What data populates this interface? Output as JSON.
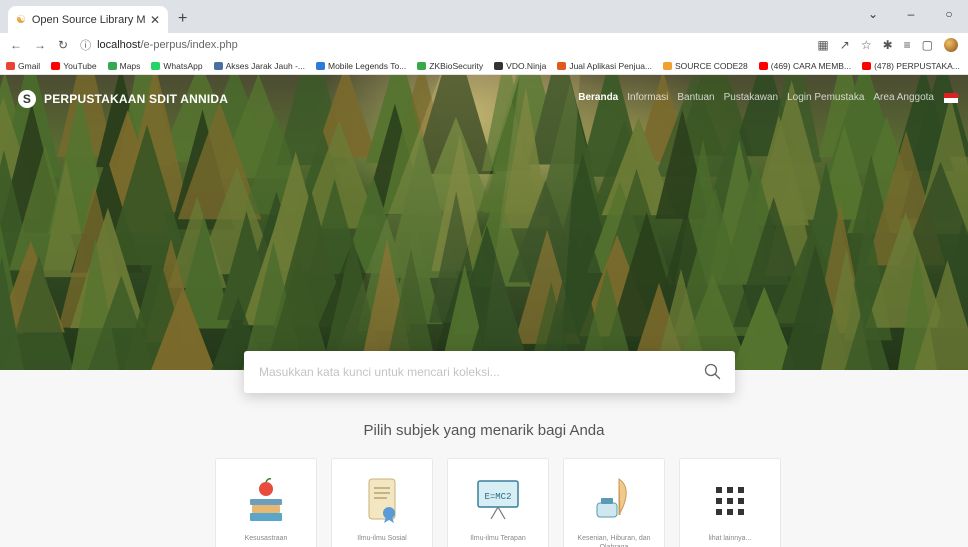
{
  "browser": {
    "tab_title": "Open Source Library Manageme",
    "url_host": "localhost",
    "url_path": "/e-perpus/index.php",
    "bookmarks": [
      {
        "label": "Gmail",
        "color": "#ea4335"
      },
      {
        "label": "YouTube",
        "color": "#ff0000"
      },
      {
        "label": "Maps",
        "color": "#34a853"
      },
      {
        "label": "WhatsApp",
        "color": "#25d366"
      },
      {
        "label": "Akses Jarak Jauh -...",
        "color": "#4a6fa5"
      },
      {
        "label": "Mobile Legends To...",
        "color": "#2b7bd8"
      },
      {
        "label": "ZKBioSecurity",
        "color": "#3aa845"
      },
      {
        "label": "VDO.Ninja",
        "color": "#333333"
      },
      {
        "label": "Jual Aplikasi Penjua...",
        "color": "#e0581f"
      },
      {
        "label": "SOURCE CODE28",
        "color": "#f0a030"
      },
      {
        "label": "(469) CARA MEMB...",
        "color": "#ff0000"
      },
      {
        "label": "(478) PERPUSTAKA...",
        "color": "#ff0000"
      }
    ]
  },
  "site": {
    "brand": "PERPUSTAKAAN SDIT ANNIDA",
    "nav": [
      "Beranda",
      "Informasi",
      "Bantuan",
      "Pustakawan",
      "Login Pemustaka",
      "Area Anggota"
    ],
    "search_placeholder": "Masukkan kata kunci untuk mencari koleksi...",
    "subtitle": "Pilih subjek yang menarik bagi Anda",
    "subjects": [
      {
        "label": "Kesusastraan",
        "icon": "books-apple-icon"
      },
      {
        "label": "Ilmu-ilmu Sosial",
        "icon": "scroll-icon"
      },
      {
        "label": "Ilmu-ilmu Terapan",
        "icon": "blackboard-icon"
      },
      {
        "label": "Kesenian, Hiburan, dan Olahraga",
        "icon": "ink-quill-icon"
      },
      {
        "label": "lihat lainnya...",
        "icon": "grid-icon"
      }
    ]
  }
}
